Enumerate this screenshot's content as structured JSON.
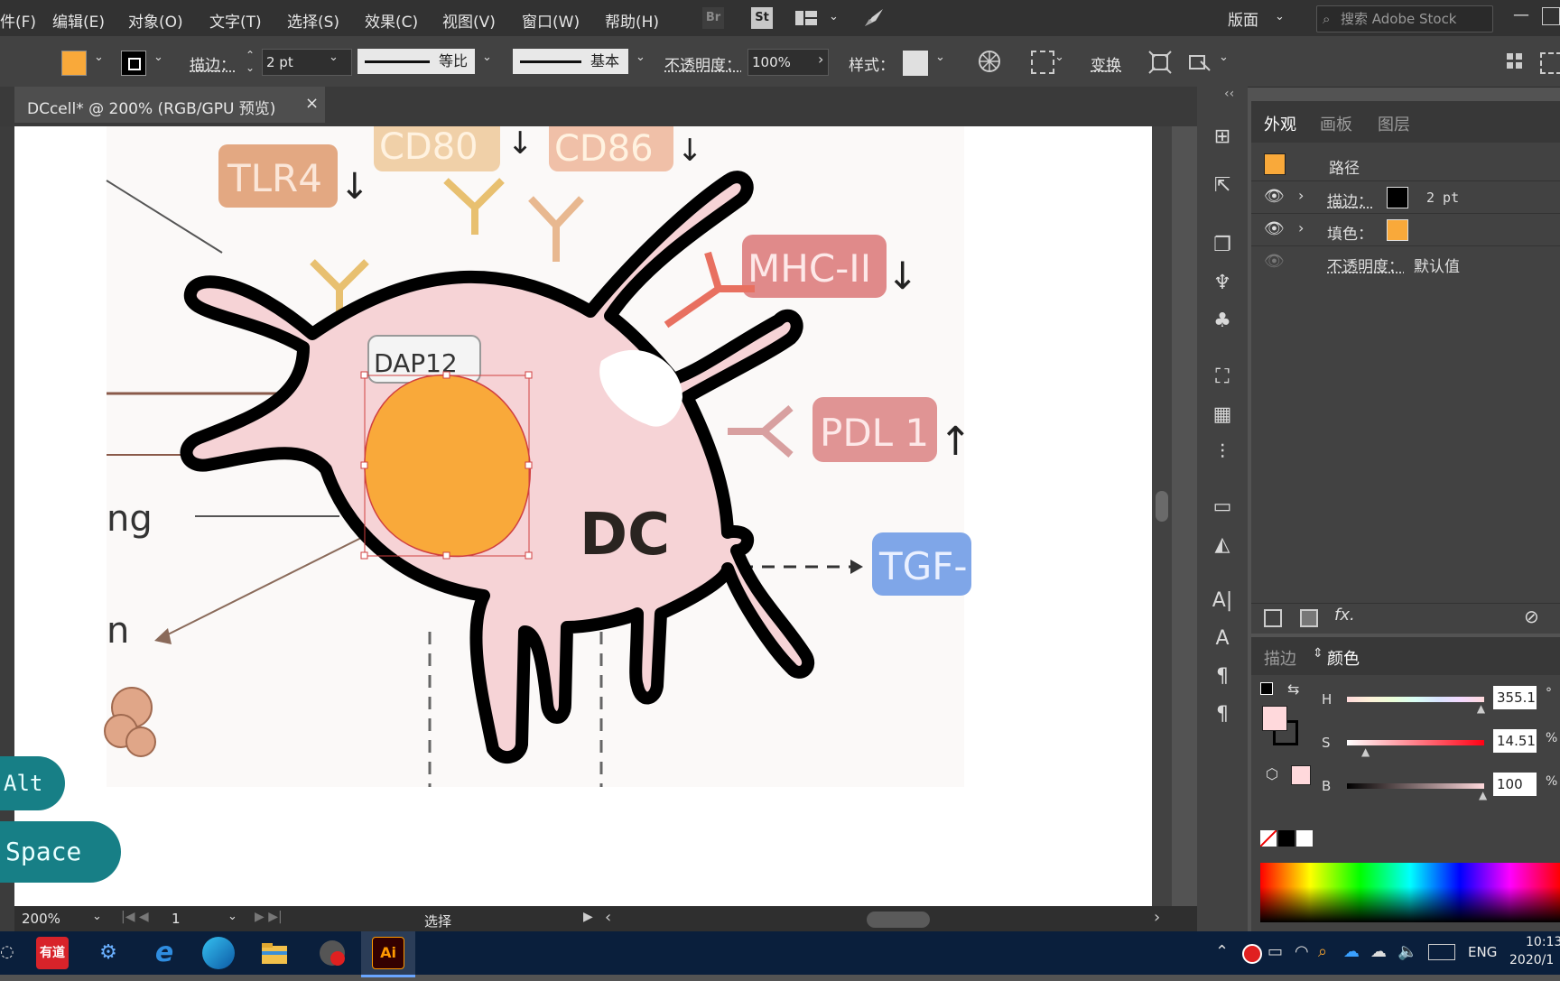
{
  "menu": {
    "items": [
      "件(F)",
      "编辑(E)",
      "对象(O)",
      "文字(T)",
      "选择(S)",
      "效果(C)",
      "视图(V)",
      "窗口(W)",
      "帮助(H)"
    ],
    "bridge_label": "Br",
    "stock_label": "St",
    "workspace": "版面",
    "search_placeholder": "搜索 Adobe Stock"
  },
  "control": {
    "stroke_label": "描边：",
    "stroke_weight": "2 pt",
    "profile": "等比",
    "brush": "基本",
    "opacity_label": "不透明度：",
    "opacity_value": "100%",
    "style_label": "样式：",
    "transform_label": "变换",
    "fill_color": "#f9a93a"
  },
  "document": {
    "tab_title": "DCcell* @ 200% (RGB/GPU 预览)",
    "close": "×"
  },
  "artwork": {
    "labels": {
      "cd80": "CD80",
      "cd86": "CD86",
      "tlr4": "TLR4",
      "mhc2": "MHC-II",
      "dap12": "DAP12",
      "pdl1": "PDL 1",
      "dc": "DC",
      "tgf": "TGF-",
      "ng": "ng",
      "n": "n"
    },
    "cell_fill": "#f6d3d6",
    "nucleus_fill": "#f9a93a"
  },
  "appearance_panel": {
    "tabs": [
      "外观",
      "画板",
      "图层"
    ],
    "object_type": "路径",
    "stroke_label": "描边：",
    "stroke_value": "2 pt",
    "fill_label": "填色：",
    "opacity_label": "不透明度：",
    "opacity_value": "默认值",
    "fx_label": "fx."
  },
  "color_panel": {
    "tabs": [
      "描边",
      "颜色"
    ],
    "h_label": "H",
    "h_value": "355.1",
    "h_unit": "°",
    "s_label": "S",
    "s_value": "14.51",
    "s_unit": "%",
    "b_label": "B",
    "b_value": "100",
    "b_unit": "%",
    "current_color": "#ffd9dc",
    "h_fraction": 0.986,
    "s_fraction": 0.145,
    "b_fraction": 1.0
  },
  "status": {
    "zoom": "200%",
    "artboard_num": "1",
    "tool": "选择"
  },
  "keys": {
    "alt": "Alt",
    "space": "Space"
  },
  "taskbar": {
    "youdao": "有道",
    "ai": "Ai",
    "lang": "ENG",
    "time": "10:13",
    "date": "2020/1"
  }
}
